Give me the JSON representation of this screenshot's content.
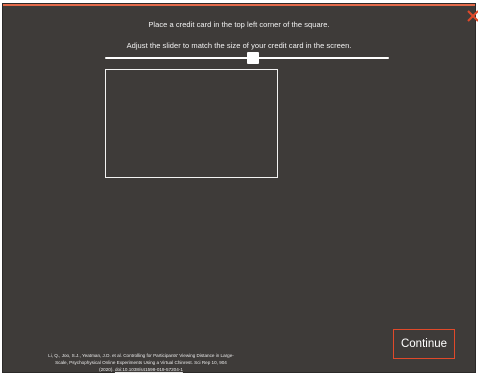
{
  "instructions": {
    "line1": "Place a credit card in the top left corner of the square.",
    "line2": "Adjust the slider to match the size of your credit card in the screen."
  },
  "slider": {
    "value_fraction": 0.52
  },
  "buttons": {
    "continue_label": "Continue"
  },
  "citation": {
    "line1": "Li, Q., Joo, S.J., Yeatman, J.D. et al. Controlling for Participants' Viewing Distance in Large-",
    "line2": "Scale, Psychophysical Online Experiments Using a Virtual Chinrest. Sci Rep 10, 904",
    "year": "(2020).",
    "doi": "doi:10.1038/s41598-019-57204-1"
  },
  "icons": {
    "close": "close-icon"
  },
  "colors": {
    "panel_background": "#3e3b39",
    "accent": "#e0492a",
    "text": "#f2f2f2"
  }
}
